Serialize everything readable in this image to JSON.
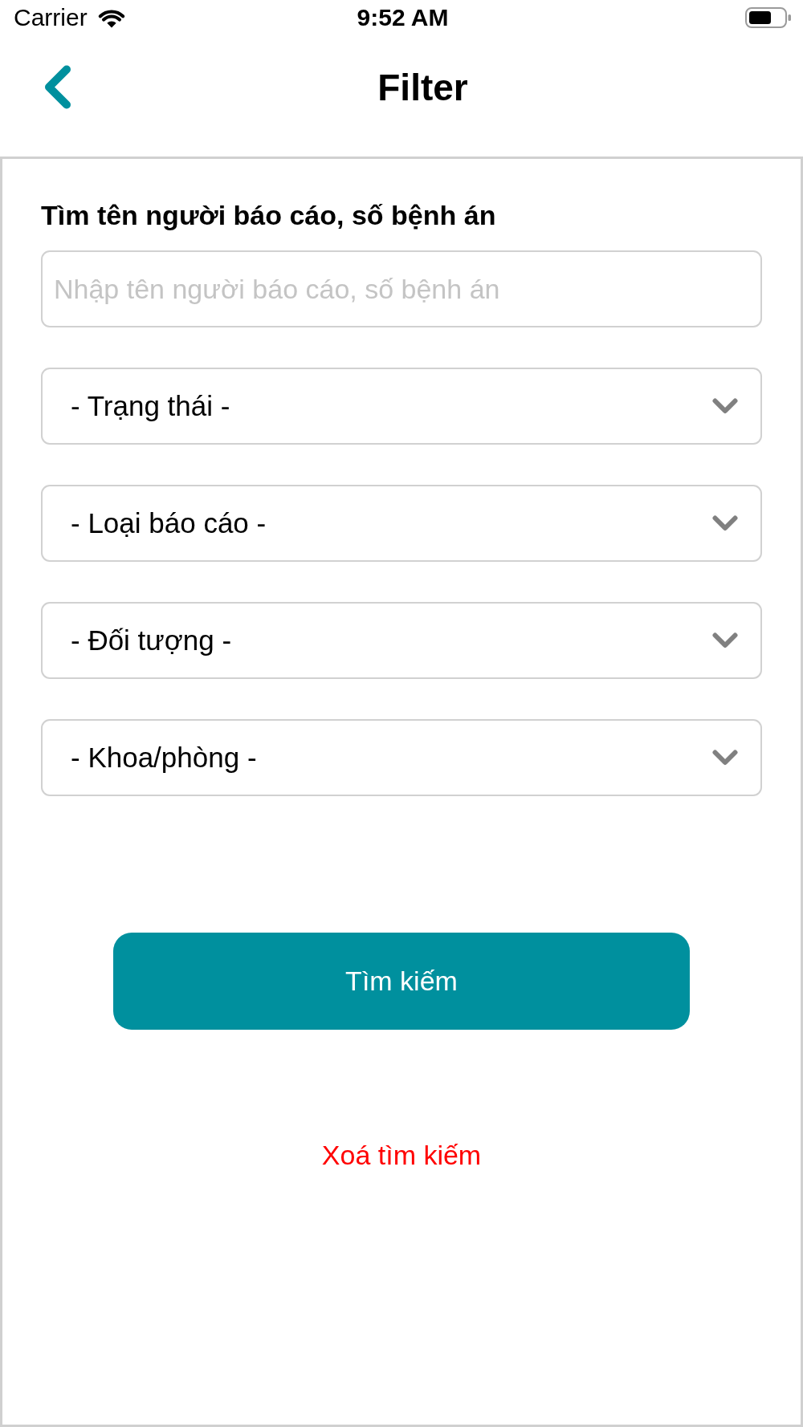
{
  "status_bar": {
    "carrier": "Carrier",
    "time": "9:52 AM"
  },
  "nav_bar": {
    "title": "Filter"
  },
  "search": {
    "label": "Tìm tên người báo cáo, số bệnh án",
    "placeholder": "Nhập tên người báo cáo, số bệnh án"
  },
  "dropdowns": [
    {
      "label": "- Trạng thái -"
    },
    {
      "label": "- Loại báo cáo -"
    },
    {
      "label": "- Đối tượng -"
    },
    {
      "label": "- Khoa/phòng -"
    }
  ],
  "actions": [
    {
      "kind": "primary",
      "label": "Tìm kiếm"
    },
    {
      "kind": "link",
      "label": "Xoá tìm kiếm"
    }
  ]
}
